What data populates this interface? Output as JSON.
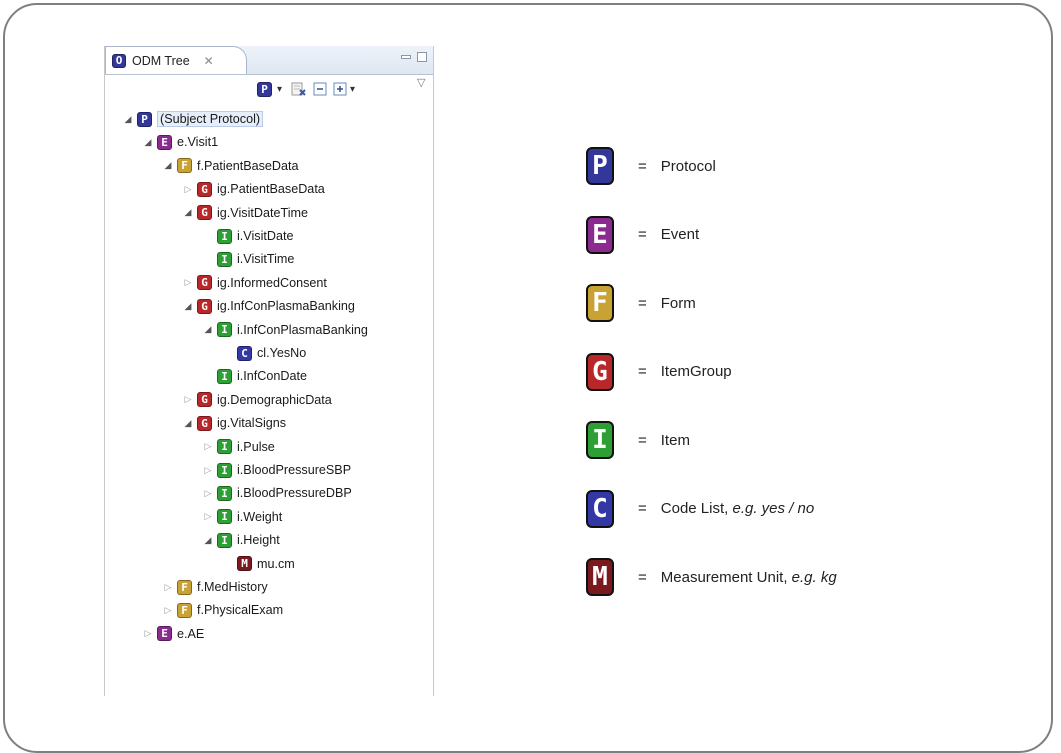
{
  "view": {
    "tab_label": "ODM Tree",
    "tab_icon_letter": "O",
    "close_glyph": "✕",
    "toolbar": {
      "protocol_letter": "P",
      "dropdown_glyph": "▾",
      "view_menu_glyph": "▽"
    }
  },
  "colors": {
    "P": "#34379a",
    "E": "#8b2a8f",
    "F": "#c9a234",
    "G": "#b8282a",
    "I": "#2e9f34",
    "C": "#3438a5",
    "M": "#7a1a1f"
  },
  "tree": [
    {
      "label": "(Subject Protocol)",
      "type": "P",
      "depth": 0,
      "twisty": "open",
      "selected": true
    },
    {
      "label": "e.Visit1",
      "type": "E",
      "depth": 1,
      "twisty": "open"
    },
    {
      "label": "f.PatientBaseData",
      "type": "F",
      "depth": 2,
      "twisty": "open"
    },
    {
      "label": "ig.PatientBaseData",
      "type": "G",
      "depth": 3,
      "twisty": "closed"
    },
    {
      "label": "ig.VisitDateTime",
      "type": "G",
      "depth": 3,
      "twisty": "open"
    },
    {
      "label": "i.VisitDate",
      "type": "I",
      "depth": 4,
      "twisty": "none"
    },
    {
      "label": "i.VisitTime",
      "type": "I",
      "depth": 4,
      "twisty": "none"
    },
    {
      "label": "ig.InformedConsent",
      "type": "G",
      "depth": 3,
      "twisty": "closed"
    },
    {
      "label": "ig.InfConPlasmaBanking",
      "type": "G",
      "depth": 3,
      "twisty": "open"
    },
    {
      "label": "i.InfConPlasmaBanking",
      "type": "I",
      "depth": 4,
      "twisty": "open"
    },
    {
      "label": "cl.YesNo",
      "type": "C",
      "depth": 5,
      "twisty": "none"
    },
    {
      "label": "i.InfConDate",
      "type": "I",
      "depth": 4,
      "twisty": "none"
    },
    {
      "label": "ig.DemographicData",
      "type": "G",
      "depth": 3,
      "twisty": "closed"
    },
    {
      "label": "ig.VitalSigns",
      "type": "G",
      "depth": 3,
      "twisty": "open"
    },
    {
      "label": "i.Pulse",
      "type": "I",
      "depth": 4,
      "twisty": "closed"
    },
    {
      "label": "i.BloodPressureSBP",
      "type": "I",
      "depth": 4,
      "twisty": "closed"
    },
    {
      "label": "i.BloodPressureDBP",
      "type": "I",
      "depth": 4,
      "twisty": "closed"
    },
    {
      "label": "i.Weight",
      "type": "I",
      "depth": 4,
      "twisty": "closed"
    },
    {
      "label": "i.Height",
      "type": "I",
      "depth": 4,
      "twisty": "open"
    },
    {
      "label": "mu.cm",
      "type": "M",
      "depth": 5,
      "twisty": "none"
    },
    {
      "label": "f.MedHistory",
      "type": "F",
      "depth": 2,
      "twisty": "closed"
    },
    {
      "label": "f.PhysicalExam",
      "type": "F",
      "depth": 2,
      "twisty": "closed"
    },
    {
      "label": "e.AE",
      "type": "E",
      "depth": 1,
      "twisty": "closed"
    }
  ],
  "legend": [
    {
      "letter": "P",
      "eq": "=",
      "text": "Protocol",
      "example": ""
    },
    {
      "letter": "E",
      "eq": "=",
      "text": "Event",
      "example": ""
    },
    {
      "letter": "F",
      "eq": "=",
      "text": "Form",
      "example": ""
    },
    {
      "letter": "G",
      "eq": "=",
      "text": "ItemGroup",
      "example": ""
    },
    {
      "letter": "I",
      "eq": "=",
      "text": "Item",
      "example": ""
    },
    {
      "letter": "C",
      "eq": "=",
      "text": "Code List, ",
      "example": "e.g. yes / no"
    },
    {
      "letter": "M",
      "eq": "=",
      "text": "Measurement Unit, ",
      "example": "e.g. kg"
    }
  ]
}
